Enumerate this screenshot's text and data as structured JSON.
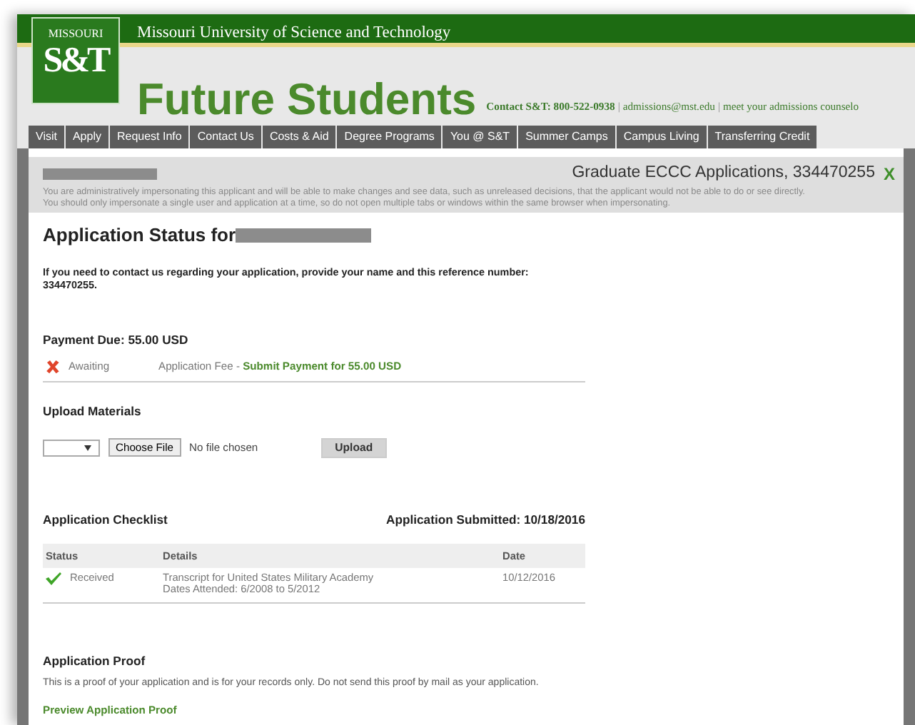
{
  "university": "Missouri University of Science and Technology",
  "logo": {
    "top": "MISSOURI",
    "main": "S&T"
  },
  "site_title": "Future Students",
  "contact": {
    "label": "Contact S&T: 800-522-0938",
    "separator": "|",
    "links": [
      "admissions@mst.edu",
      "meet your admissions counselo"
    ]
  },
  "nav": [
    "Visit",
    "Apply",
    "Request Info",
    "Contact Us",
    "Costs & Aid",
    "Degree Programs",
    "You @ S&T",
    "Summer Camps",
    "Campus Living",
    "Transferring Credit"
  ],
  "impersonation": {
    "application": "Graduate ECCC Applications, 334470255",
    "close": "X",
    "notice": [
      "You are administratively impersonating this applicant and will be able to make changes and see data, such as unreleased decisions, that the applicant would not be able to do or see directly.",
      "You should only impersonate a single user and application at a time, so do not open multiple tabs or windows within the same browser when impersonating."
    ]
  },
  "status_heading": "Application Status for",
  "contact_note": [
    "If you need to contact us regarding your application, provide your name and this reference number:",
    "334470255."
  ],
  "payment": {
    "heading": "Payment Due: 55.00 USD",
    "items": [
      {
        "kind": "awaiting",
        "status": "Awaiting",
        "item": "Application Fee - ",
        "link": "Submit Payment for 55.00 USD"
      }
    ]
  },
  "upload": {
    "heading": "Upload Materials",
    "file_button": "Choose File",
    "file_status": "No file chosen",
    "submit": "Upload"
  },
  "checklist": {
    "heading": "Application Checklist",
    "submitted": "Application Submitted: 10/18/2016",
    "columns": [
      "Status",
      "Details",
      "Date"
    ],
    "rows": [
      {
        "kind": "received",
        "status": "Received",
        "details": "Transcript for United States Military Academy",
        "sub": "Dates Attended: 6/2008 to 5/2012",
        "date": "10/12/2016"
      }
    ]
  },
  "proof": {
    "heading": "Application Proof",
    "text": "This is a proof of your application and is for your records only. Do not send this proof by mail as your application.",
    "link": "Preview Application Proof"
  }
}
